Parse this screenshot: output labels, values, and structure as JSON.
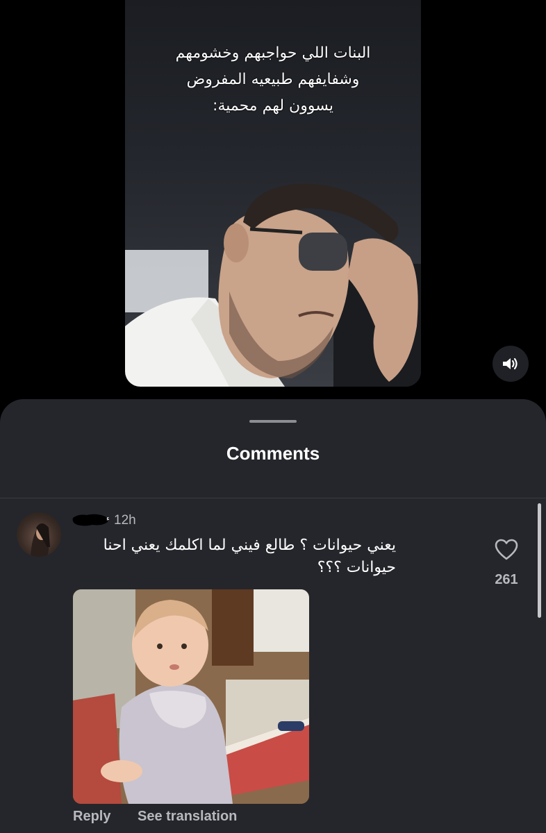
{
  "video": {
    "caption_lines": [
      "البنات اللي حواجبهم وخشومهم",
      "وشفايفهم طبيعيه المفروض",
      "يسوون لهم محمية:"
    ],
    "sound_icon": "speaker-icon"
  },
  "comments_panel": {
    "title": "Comments",
    "comment": {
      "time": "12h",
      "text_lines": [
        "يعني حيوانات ؟ طالع فيني لما اكلمك يعني احنا",
        "حيوانات ؟؟؟"
      ],
      "like_icon": "heart-icon",
      "like_count": "261",
      "reply_label": "Reply",
      "translate_label": "See translation"
    }
  },
  "colors": {
    "background": "#000000",
    "sheet": "#25262b",
    "muted_text": "#b8b9bd"
  }
}
